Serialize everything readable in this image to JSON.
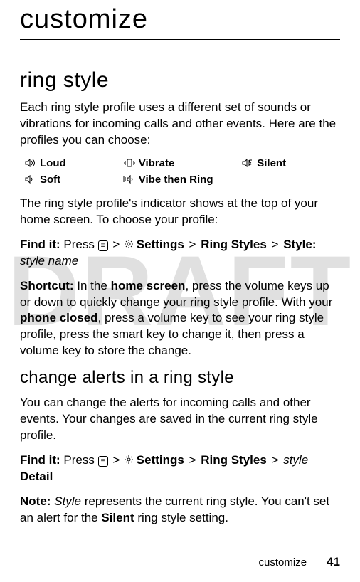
{
  "watermark": "DRAFT",
  "title": "customize",
  "section1": {
    "heading": "ring style",
    "intro": "Each ring style profile uses a different set of sounds or vibrations for incoming calls and other events. Here are the profiles you can choose:",
    "styles": {
      "loud": "Loud",
      "vibrate": "Vibrate",
      "silent": "Silent",
      "soft": "Soft",
      "vibe_then_ring": "Vibe then Ring"
    },
    "after_table": "The ring style profile's indicator shows at the top of your home screen. To choose your profile:",
    "find_it_label": "Find it:",
    "find_it_press": "Press",
    "nav": {
      "settings": "Settings",
      "ring_styles": "Ring Styles",
      "style_prefix": "Style:",
      "style_name": "style name"
    },
    "shortcut_label": "Shortcut:",
    "shortcut_part1": "In the",
    "home_screen": "home screen",
    "shortcut_part2": ", press the volume keys up or down to quickly change your ring style profile. With your",
    "phone_closed": "phone closed",
    "shortcut_part3": ", press a volume key to see your ring style profile, press the smart key to change it, then press a volume key to store the change."
  },
  "section2": {
    "heading": "change alerts in a ring style",
    "intro": "You can change the alerts for incoming calls and other events. Your changes are saved in the current ring style profile.",
    "find_it_label": "Find it:",
    "find_it_press": "Press",
    "nav": {
      "settings": "Settings",
      "ring_styles": "Ring Styles",
      "style_ital": "style",
      "detail": "Detail"
    },
    "note_label": "Note:",
    "note_ital": "Style",
    "note_rest1": "represents the current ring style. You can't set an alert for the",
    "silent": "Silent",
    "note_rest2": "ring style setting."
  },
  "footer": {
    "label": "customize",
    "page": "41"
  },
  "glyphs": {
    "gt": ">",
    "menu_key": "≡"
  }
}
